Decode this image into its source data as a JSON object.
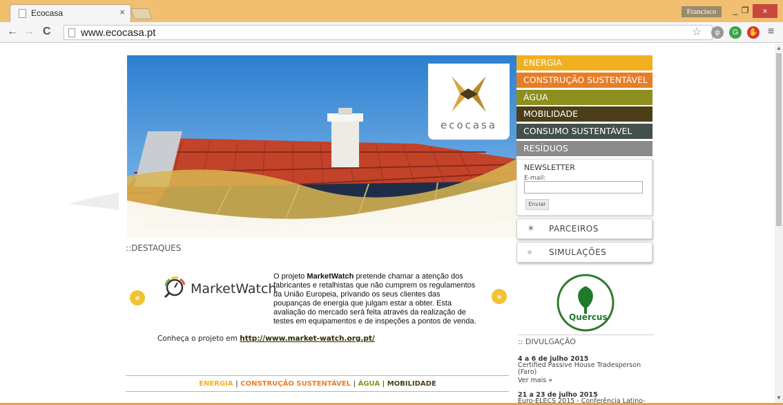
{
  "browser": {
    "tab_title": "Ecocasa",
    "tab_close": "×",
    "profile_name": "Francisco",
    "minimize": "_",
    "maximize": "❐",
    "close": "×",
    "url": "www.ecocasa.pt",
    "back": "←",
    "forward": "→",
    "reload": "C",
    "star": "☆",
    "menu": "≡"
  },
  "site": {
    "logo_text": "ecocasa",
    "menu": [
      {
        "label": "ENERGIA",
        "color": "#f0b020"
      },
      {
        "label": "CONSTRUÇÃO SUSTENTÁVEL",
        "color": "#e87d27"
      },
      {
        "label": "ÁGUA",
        "color": "#8c8f1e"
      },
      {
        "label": "MOBILIDADE",
        "color": "#4c3f18"
      },
      {
        "label": "CONSUMO SUSTENTÁVEL",
        "color": "#44504a"
      },
      {
        "label": "RESÍDUOS",
        "color": "#8a8a8a"
      }
    ],
    "newsletter": {
      "title": "NEWSLETTER",
      "email_label": "E-mail:",
      "email_value": "",
      "submit": "Enviar"
    },
    "parceiros": "PARCEIROS",
    "simulacoes": "SIMULAÇÕES",
    "destaques": "::DESTAQUES",
    "feature": {
      "brand": "MarketWatch",
      "p1": "O projeto",
      "p1_bold": "MarketWatch",
      "p2": "pretende chamar a atenção dos fabricantes e retalhistas que não cumprem os regulamentos da União Europeia, privando os seus clientes das poupanças de energia que julgam estar a obter. Esta avaliação do mercado será feita através da realização de testes em equipamentos e de inspeções a pontos de venda.",
      "link_prefix": "Conheça o projeto em",
      "link": "http://www.market-watch.org.pt/"
    },
    "prev": "«",
    "next": "»",
    "bottom_nav": [
      {
        "label": "ENERGIA",
        "color": "#f0b020"
      },
      {
        "label": "CONSTRUÇÃO SUSTENTÁVEL",
        "color": "#e87d27"
      },
      {
        "label": "ÁGUA",
        "color": "#8c8f1e"
      },
      {
        "label": "MOBILIDADE",
        "color": "#4c3f18"
      }
    ],
    "bottom_sep": "|",
    "divulgacao_title": ":: DIVULGAÇÃO",
    "news": [
      {
        "date": "4 a 6 de julho 2015",
        "text": "Certified Passive House Tradesperson (Faro)",
        "more": "Ver mais »"
      },
      {
        "date": "21 a 23 de julho 2015",
        "text": "Euro-ELECS 2015 - Conferência Latino-"
      }
    ],
    "quercus": "Quercus"
  }
}
